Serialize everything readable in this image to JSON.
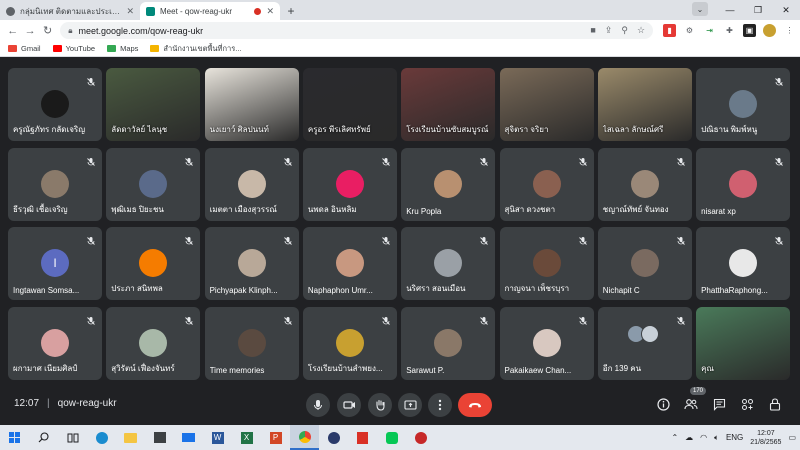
{
  "browser": {
    "tabs": [
      {
        "title": "กลุ่มนิเทศ ติดตามและประเมินผลการจัด",
        "active": false
      },
      {
        "title": "Meet - qow-reag-ukr",
        "active": true
      }
    ],
    "url": "meet.google.com/qow-reag-ukr",
    "bookmarks": [
      "Gmail",
      "YouTube",
      "Maps",
      "สำนักงานเขตพื้นที่การ..."
    ]
  },
  "participants": [
    {
      "name": "ครูณัฐภัทร กลัดเจริญ",
      "type": "avatar",
      "color": "#1a1a1a"
    },
    {
      "name": "ลัดดาวัลย์ ไลนุช",
      "type": "video",
      "color": "#4a5a40"
    },
    {
      "name": "นงเยาว์ ศิลปนนท์",
      "type": "video",
      "color": "#e8e4dc"
    },
    {
      "name": "ครูอร พีรเลิศทรัพย์",
      "type": "video",
      "color": "#2a2a2e"
    },
    {
      "name": "โรงเรียนบ้านซับสมบูรณ์",
      "type": "video",
      "color": "#6a3a3a"
    },
    {
      "name": "สุจิตรา จริยา",
      "type": "video",
      "color": "#7a6a58"
    },
    {
      "name": "ไสเฉลา ลักษณ์ศรี",
      "type": "video",
      "color": "#9a8a6a"
    },
    {
      "name": "ปณิธาน พิมพ์หนู",
      "type": "avatar",
      "color": "#6a7a8a"
    },
    {
      "name": "ธีรวุฒิ เชื้อเจริญ",
      "type": "avatar",
      "color": "#8a7a6a"
    },
    {
      "name": "พุฒิเมธ ปิยะชน",
      "type": "avatar",
      "color": "#5a6a8a"
    },
    {
      "name": "เมตตา เมืองสุวรรณ์",
      "type": "avatar",
      "color": "#c8b8a8"
    },
    {
      "name": "นพดล อินหลิม",
      "type": "avatar",
      "color": "#e91e63",
      "letter": ""
    },
    {
      "name": "Kru Popla",
      "type": "avatar",
      "color": "#b89070"
    },
    {
      "name": "สุนิสา ดวงชตา",
      "type": "avatar",
      "color": "#8a6050"
    },
    {
      "name": "ชญาณ์ทัพย์ จันทอง",
      "type": "avatar",
      "color": "#9a8878"
    },
    {
      "name": "nisarat xp",
      "type": "avatar",
      "color": "#d06070"
    },
    {
      "name": "Ingtawan Somsa...",
      "type": "letter",
      "color": "#5c6bc0",
      "letter": "I"
    },
    {
      "name": "ประภา สนิทพล",
      "type": "letter",
      "color": "#f57c00",
      "letter": ""
    },
    {
      "name": "Pichyapak Klinph...",
      "type": "avatar",
      "color": "#b8a898"
    },
    {
      "name": "Naphaphon Umr...",
      "type": "avatar",
      "color": "#c89880"
    },
    {
      "name": "นริศรา สอนเมือน",
      "type": "letter",
      "color": "#9aa0a6",
      "letter": ""
    },
    {
      "name": "กาญจนา เพ็ชรบุรา",
      "type": "avatar",
      "color": "#6a4a3a"
    },
    {
      "name": "Nichapit C",
      "type": "avatar",
      "color": "#7a6a60"
    },
    {
      "name": "PhatthaRaphong...",
      "type": "avatar",
      "color": "#e8e8e8"
    },
    {
      "name": "ผกามาศ เนียมศิลป์",
      "type": "avatar",
      "color": "#d8a0a0"
    },
    {
      "name": "สุวิรัตน์ เฟื่องจันทร์",
      "type": "avatar",
      "color": "#a8b8a8"
    },
    {
      "name": "Time memories",
      "type": "avatar",
      "color": "#5a4a40"
    },
    {
      "name": "โรงเรียนบ้านสำพยง...",
      "type": "avatar",
      "color": "#c8a030"
    },
    {
      "name": "Sarawut P.",
      "type": "avatar",
      "color": "#8a7868"
    },
    {
      "name": "Pakaikaew Chan...",
      "type": "avatar",
      "color": "#d8c8c0"
    },
    {
      "name": "อีก 139 คน",
      "type": "more",
      "color": "#5f6368"
    },
    {
      "name": "คุณ",
      "type": "video",
      "color": "#4a7a5a"
    }
  ],
  "meeting": {
    "time": "12:07",
    "code": "qow-reag-ukr",
    "participant_count": "170"
  },
  "taskbar": {
    "time": "12:07",
    "date": "21/8/2565",
    "lang": "ENG"
  }
}
